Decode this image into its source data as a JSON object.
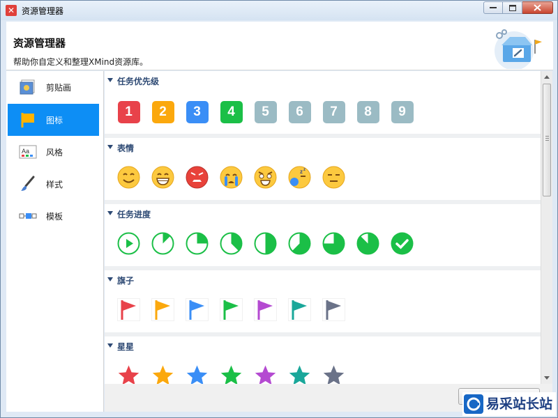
{
  "window": {
    "title": "资源管理器"
  },
  "header": {
    "title": "资源管理器",
    "subtitle": "帮助你自定义和整理XMind资源库。"
  },
  "sidebar": {
    "items": [
      {
        "label": "剪贴画",
        "icon": "clipart-icon",
        "active": false
      },
      {
        "label": "图标",
        "icon": "flag-icon",
        "active": true
      },
      {
        "label": "风格",
        "icon": "theme-icon",
        "active": false
      },
      {
        "label": "样式",
        "icon": "brush-icon",
        "active": false
      },
      {
        "label": "模板",
        "icon": "template-icon",
        "active": false
      }
    ]
  },
  "sections": {
    "priority": {
      "title": "任务优先级",
      "items": [
        {
          "label": "1",
          "color": "#e8424a"
        },
        {
          "label": "2",
          "color": "#fba80d"
        },
        {
          "label": "3",
          "color": "#3a8ef6"
        },
        {
          "label": "4",
          "color": "#1bbf47"
        },
        {
          "label": "5",
          "color": "#9bbbc4"
        },
        {
          "label": "6",
          "color": "#9bbbc4"
        },
        {
          "label": "7",
          "color": "#9bbbc4"
        },
        {
          "label": "8",
          "color": "#9bbbc4"
        },
        {
          "label": "9",
          "color": "#9bbbc4"
        }
      ]
    },
    "smiley": {
      "title": "表情",
      "items": [
        "smile-icon",
        "laugh-icon",
        "angry-icon",
        "cry-icon",
        "surprise-icon",
        "sleepy-icon",
        "boring-icon"
      ]
    },
    "progress": {
      "title": "任务进度",
      "color": "#1bbf47",
      "items": [
        {
          "icon": "start-icon",
          "fraction": 0
        },
        {
          "icon": "progress-1-8-icon",
          "fraction": 0.125
        },
        {
          "icon": "progress-1-4-icon",
          "fraction": 0.25
        },
        {
          "icon": "progress-3-8-icon",
          "fraction": 0.375
        },
        {
          "icon": "progress-1-2-icon",
          "fraction": 0.5
        },
        {
          "icon": "progress-5-8-icon",
          "fraction": 0.625
        },
        {
          "icon": "progress-3-4-icon",
          "fraction": 0.75
        },
        {
          "icon": "progress-7-8-icon",
          "fraction": 0.875
        },
        {
          "icon": "done-icon",
          "fraction": 1
        }
      ]
    },
    "flags": {
      "title": "旗子",
      "colors": [
        "#e8424a",
        "#fba80d",
        "#3a8ef6",
        "#1bbf47",
        "#b44ad1",
        "#1aa79a",
        "#6a7288"
      ]
    },
    "stars": {
      "title": "星星",
      "colors": [
        "#e8424a",
        "#fba80d",
        "#3a8ef6",
        "#1bbf47",
        "#b44ad1",
        "#1aa79a",
        "#6a7288"
      ]
    }
  },
  "footer": {
    "button_label": ""
  },
  "watermark": {
    "text": "易采站长站"
  }
}
